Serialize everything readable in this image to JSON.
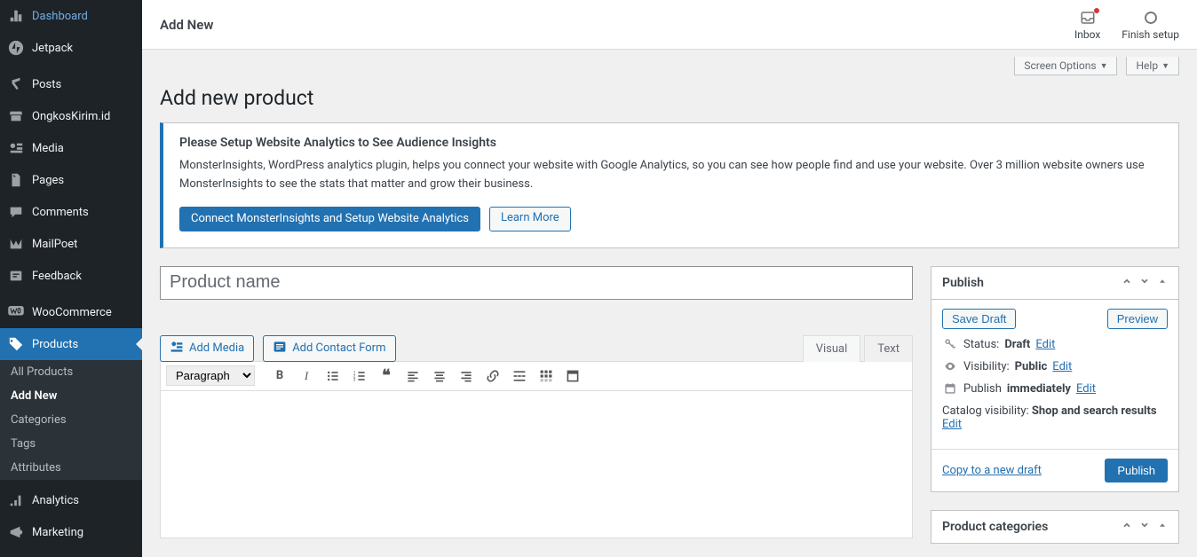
{
  "header": {
    "title": "Add New",
    "inbox": "Inbox",
    "finish_setup": "Finish setup"
  },
  "screen_options": "Screen Options",
  "help": "Help",
  "page_title": "Add new product",
  "notice": {
    "heading": "Please Setup Website Analytics to See Audience Insights",
    "body": "MonsterInsights, WordPress analytics plugin, helps you connect your website with Google Analytics, so you can see how people find and use your website. Over 3 million website owners use MonsterInsights to see the stats that matter and grow their business.",
    "cta_primary": "Connect MonsterInsights and Setup Website Analytics",
    "cta_secondary": "Learn More"
  },
  "product_name_placeholder": "Product name",
  "editor": {
    "add_media": "Add Media",
    "add_contact_form": "Add Contact Form",
    "tab_visual": "Visual",
    "tab_text": "Text",
    "format_select": "Paragraph"
  },
  "publish": {
    "title": "Publish",
    "save_draft": "Save Draft",
    "preview": "Preview",
    "status_label": "Status:",
    "status_value": "Draft",
    "visibility_label": "Visibility:",
    "visibility_value": "Public",
    "publish_label": "Publish",
    "publish_value": "immediately",
    "catalog_label": "Catalog visibility:",
    "catalog_value": "Shop and search results",
    "edit": "Edit",
    "copy": "Copy to a new draft",
    "publish_btn": "Publish"
  },
  "categories_box_title": "Product categories",
  "sidebar": {
    "items": [
      {
        "label": "Dashboard",
        "icon": "dashboard"
      },
      {
        "label": "Jetpack",
        "icon": "jetpack"
      },
      {
        "label": "Posts",
        "icon": "pin"
      },
      {
        "label": "OngkosKirim.id",
        "icon": "store"
      },
      {
        "label": "Media",
        "icon": "media"
      },
      {
        "label": "Pages",
        "icon": "pages"
      },
      {
        "label": "Comments",
        "icon": "comments"
      },
      {
        "label": "MailPoet",
        "icon": "mailpoet"
      },
      {
        "label": "Feedback",
        "icon": "feedback"
      },
      {
        "label": "WooCommerce",
        "icon": "woo"
      },
      {
        "label": "Products",
        "icon": "products"
      },
      {
        "label": "Analytics",
        "icon": "analytics"
      },
      {
        "label": "Marketing",
        "icon": "marketing"
      }
    ],
    "submenu": [
      "All Products",
      "Add New",
      "Categories",
      "Tags",
      "Attributes"
    ]
  }
}
